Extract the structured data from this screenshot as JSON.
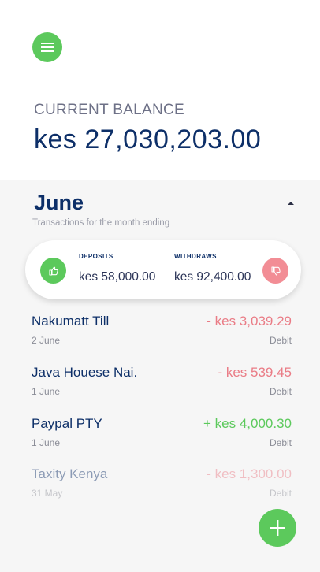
{
  "header": {
    "menu_icon": "hamburger-menu-icon",
    "balance_label": "CURRENT BALANCE",
    "balance_value": "kes 27,030,203.00"
  },
  "month": {
    "title": "June",
    "subtitle": "Transactions for the month ending",
    "toggle_icon": "caret-up-icon"
  },
  "summary": {
    "deposits_label": "DEPOSITS",
    "deposits_value": "kes 58,000.00",
    "deposits_icon": "thumbs-up-icon",
    "withdraws_label": "WITHDRAWS",
    "withdraws_value": "kes 92,400.00",
    "withdraws_icon": "thumbs-down-icon"
  },
  "transactions": [
    {
      "name": "Nakumatt Till",
      "date": "2 June",
      "amount": "- kes 3,039.29",
      "type": "Debit"
    },
    {
      "name": "Java Houese Nai.",
      "date": "1 June",
      "amount": "- kes 539.45",
      "type": "Debit"
    },
    {
      "name": "Paypal PTY",
      "date": "1 June",
      "amount": "+ kes 4,000.30",
      "type": "Debit"
    },
    {
      "name": "Taxity Kenya",
      "date": "31 May",
      "amount": "- kes 1,300.00",
      "type": "Debit"
    }
  ],
  "fab_icon": "plus-icon",
  "colors": {
    "accent_green": "#5cc95c",
    "accent_red": "#f28d95",
    "navy": "#0d2f68",
    "bg_light": "#f6f6f6"
  }
}
